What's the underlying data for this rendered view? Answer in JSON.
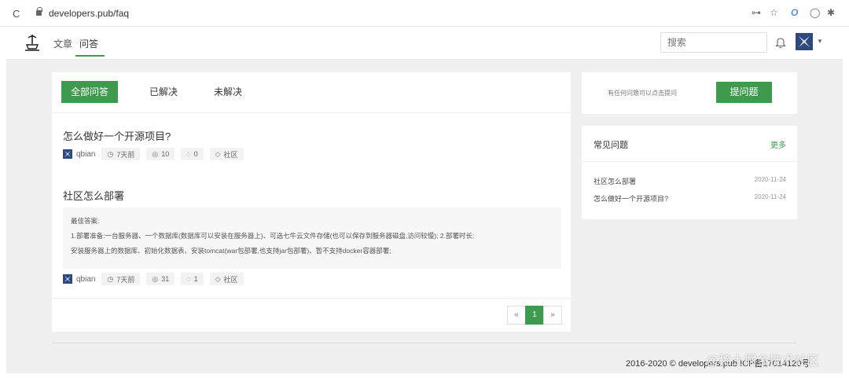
{
  "browser": {
    "url": "developers.pub/faq",
    "reload_icon": "C",
    "extension_icons": [
      "key-icon",
      "star-icon",
      "extension-icon",
      "circle-icon",
      "puzzle-icon"
    ]
  },
  "nav": {
    "items": [
      "文章",
      "问答"
    ],
    "active": "问答",
    "search_placeholder": "搜索"
  },
  "tabs": {
    "all": "全部问答",
    "solved": "已解决",
    "unsolved": "未解决"
  },
  "questions": [
    {
      "title": "怎么做好一个开源项目?",
      "author": "qbian",
      "time": "7天前",
      "views": "10",
      "comments": "0",
      "tag": "社区"
    },
    {
      "title": "社区怎么部署",
      "best_answer_label": "最佳答案:",
      "best_answer_line1": "1.部署准备:一台服务器、一个数据库(数据库可以安装在服务器上)、可选七牛云文件存储(也可以保存到服务器磁盘,访问较慢); 2.部署时长:",
      "best_answer_line2": "安装服务器上的数据库、初始化数据表、安装tomcat(war包部署,也支持jar包部署)、暂不支持docker容器部署;",
      "author": "qbian",
      "time": "7天前",
      "views": "31",
      "comments": "1",
      "tag": "社区"
    }
  ],
  "pagination": {
    "prev": "«",
    "current": "1",
    "next": "»"
  },
  "ask": {
    "hint": "有任何问题可以点击提问",
    "button": "提问题"
  },
  "faq": {
    "title": "常见问题",
    "more": "更多",
    "items": [
      {
        "title": "社区怎么部署",
        "date": "2020-11-24"
      },
      {
        "title": "怎么做好一个开源项目?",
        "date": "2020-11-24"
      }
    ]
  },
  "footer": {
    "text": "2016-2020 © developers.pub ICP备17014120号"
  },
  "watermark": "@稀土掘金技术社区",
  "colors": {
    "accent": "#3e9a4d"
  }
}
